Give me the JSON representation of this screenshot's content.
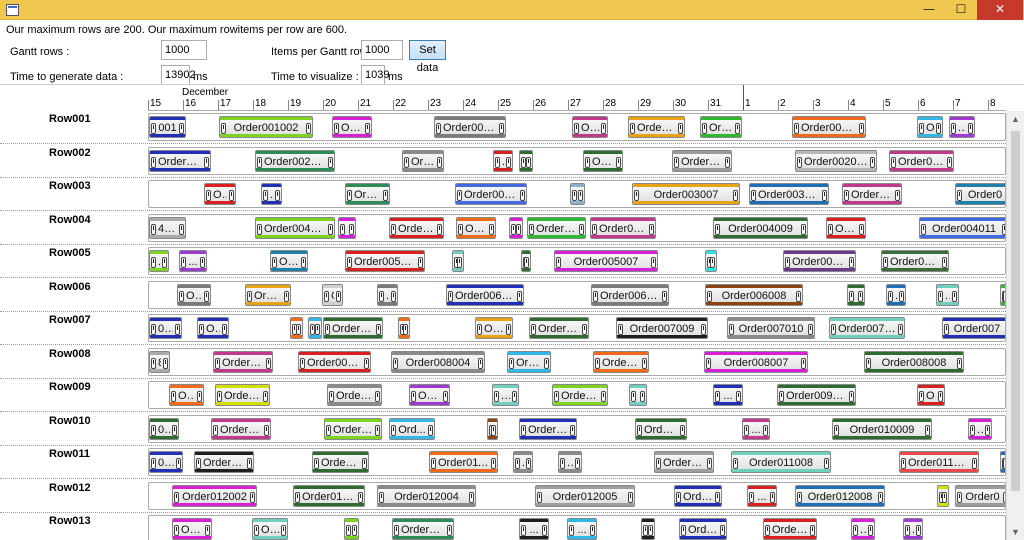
{
  "window": {
    "icon": "app-window-icon",
    "minimize_label": "—",
    "maximize_label": "☐",
    "close_label": "✕"
  },
  "info_text": "Our maximum rows are 200. Our maximum rowitems per row are 600.",
  "controls": {
    "gantt_rows_label": "Gantt rows :",
    "gantt_rows_value": "1000",
    "items_per_row_label": "Items per Gantt row :",
    "items_per_row_value": "1000",
    "set_data_label": "Set data",
    "time_generate_label": "Time to generate data :",
    "time_generate_value": "13902",
    "time_generate_unit": "ms",
    "time_visualize_label": "Time to visualize :",
    "time_visualize_value": "1039",
    "time_visualize_unit": "ms"
  },
  "timeline": {
    "month": "December",
    "days": [
      "15",
      "16",
      "17",
      "18",
      "19",
      "20",
      "21",
      "22",
      "23",
      "24",
      "25",
      "26",
      "27",
      "28",
      "29",
      "30",
      "31",
      "1",
      "2",
      "3",
      "4",
      "5",
      "6",
      "7",
      "8"
    ]
  },
  "rows": [
    {
      "name": "Row001",
      "items": [
        [
          "001",
          0,
          37,
          "#1f2fb8"
        ],
        [
          "Order001002",
          70,
          94,
          "#7ed321"
        ],
        [
          "Ord...",
          183,
          40,
          "#d61fd6"
        ],
        [
          "Order001004",
          285,
          72,
          "#7a7a7a"
        ],
        [
          "Or...",
          423,
          36,
          "#c0398a"
        ],
        [
          "Order00...",
          479,
          57,
          "#e8a317"
        ],
        [
          "Ord...",
          551,
          42,
          "#2eb82e"
        ],
        [
          "Order001008",
          643,
          74,
          "#f06a1a"
        ],
        [
          "O...",
          768,
          26,
          "#2fb7e8"
        ],
        [
          "...",
          800,
          26,
          "#9e3ad1"
        ]
      ]
    },
    {
      "name": "Row002",
      "items": [
        [
          "Order002002",
          0,
          62,
          "#1f2fb8"
        ],
        [
          "Order002003",
          106,
          80,
          "#2e8b57"
        ],
        [
          "Ord...",
          253,
          42,
          "#8a8a8a"
        ],
        [
          "...",
          344,
          20,
          "#d91f1f"
        ],
        [
          "...",
          370,
          14,
          "#2e6b2e"
        ],
        [
          "Ord...",
          434,
          40,
          "#2e6b2e"
        ],
        [
          "Order0...",
          523,
          60,
          "#9a9a9a"
        ],
        [
          "Order002009",
          646,
          82,
          "#b8b8b8"
        ],
        [
          "Order002...",
          740,
          65,
          "#c0398a"
        ]
      ]
    },
    {
      "name": "Row003",
      "items": [
        [
          "O...",
          55,
          32,
          "#d91f1f"
        ],
        [
          "...",
          112,
          21,
          "#1f2fb8"
        ],
        [
          "Orde...",
          196,
          45,
          "#2e8b57"
        ],
        [
          "Order003005",
          306,
          72,
          "#4169e1"
        ],
        [
          "...",
          421,
          15,
          "#8ab0d0"
        ],
        [
          "Order003007",
          483,
          108,
          "#e8a317"
        ],
        [
          "Order003008",
          600,
          80,
          "#1f6fb8"
        ],
        [
          "Order00...",
          693,
          60,
          "#c0398a"
        ],
        [
          "Order0",
          806,
          60,
          "#1e7fa8"
        ]
      ]
    },
    {
      "name": "Row004",
      "items": [
        [
          "4001",
          0,
          37,
          "#aaaaaa"
        ],
        [
          "Order004002",
          106,
          80,
          "#7ed321"
        ],
        [
          "...",
          189,
          18,
          "#d61fd6"
        ],
        [
          "Order0040...",
          240,
          55,
          "#d91f1f"
        ],
        [
          "Ord...",
          307,
          40,
          "#f06a1a"
        ],
        [
          "...",
          360,
          14,
          "#d61fd6"
        ],
        [
          "Order00...",
          378,
          59,
          "#2eb82e"
        ],
        [
          "Order0040...",
          441,
          66,
          "#c0398a"
        ],
        [
          "Order004009",
          564,
          95,
          "#2e6b2e"
        ],
        [
          "Ord...",
          677,
          40,
          "#d91f1f"
        ],
        [
          "Order004011",
          770,
          90,
          "#4169e1"
        ]
      ]
    },
    {
      "name": "Row005",
      "items": [
        [
          "...",
          0,
          20,
          "#7ed321"
        ],
        [
          "...",
          30,
          28,
          "#9e3ad1"
        ],
        [
          "Or...",
          121,
          38,
          "#1e7fa8"
        ],
        [
          "Order005004",
          196,
          80,
          "#d91f1f"
        ],
        [
          "...",
          303,
          12,
          "#6fcfc0"
        ],
        [
          "...",
          372,
          10,
          "#2e6b2e"
        ],
        [
          "Order005007",
          405,
          104,
          "#d61fd6"
        ],
        [
          "...",
          556,
          12,
          "#2fe0e0"
        ],
        [
          "Order005009",
          634,
          73,
          "#6b3a8a"
        ],
        [
          "Order005010",
          732,
          68,
          "#3a6b3a"
        ]
      ]
    },
    {
      "name": "Row006",
      "items": [
        [
          "Or...",
          28,
          34,
          "#7a7a7a"
        ],
        [
          "Orde...",
          96,
          46,
          "#e8a317"
        ],
        [
          "O...",
          173,
          21,
          "#d0d0d0"
        ],
        [
          "...",
          228,
          21,
          "#7a7a7a"
        ],
        [
          "Order006006",
          297,
          78,
          "#1f2fb8"
        ],
        [
          "Order006007",
          442,
          78,
          "#7a7a7a"
        ],
        [
          "Order006008",
          556,
          98,
          "#8b4513"
        ],
        [
          "...",
          698,
          18,
          "#2e6b2e"
        ],
        [
          "...",
          737,
          20,
          "#1f6fb8"
        ],
        [
          "...",
          787,
          23,
          "#6fcfc0"
        ],
        [
          "...",
          851,
          10,
          "#2eb82e"
        ]
      ]
    },
    {
      "name": "Row007",
      "items": [
        [
          "001",
          0,
          33,
          "#1f2fb8"
        ],
        [
          "O...",
          48,
          32,
          "#1f2fb8"
        ],
        [
          "...",
          141,
          13,
          "#f06a1a"
        ],
        [
          "...",
          159,
          14,
          "#2fb7e8"
        ],
        [
          "Order007...",
          174,
          60,
          "#2e6b2e"
        ],
        [
          "...",
          249,
          12,
          "#f06a1a"
        ],
        [
          "Or...",
          326,
          38,
          "#e8a317"
        ],
        [
          "Order00...",
          380,
          60,
          "#2e6b2e"
        ],
        [
          "Order007009",
          467,
          92,
          "#1f1f1f"
        ],
        [
          "Order007010",
          578,
          88,
          "#8a8a8a"
        ],
        [
          "Order007011",
          680,
          76,
          "#6fcfc0"
        ],
        [
          "Order007",
          793,
          70,
          "#1f2fb8"
        ]
      ]
    },
    {
      "name": "Row008",
      "items": [
        [
          "8001",
          0,
          21,
          "#aaaaaa"
        ],
        [
          "Order00...",
          64,
          60,
          "#c0398a"
        ],
        [
          "Order008003",
          149,
          73,
          "#d91f1f"
        ],
        [
          "Order008004",
          242,
          94,
          "#8a8a8a"
        ],
        [
          "Ord...",
          358,
          44,
          "#2fb7e8"
        ],
        [
          "Order0...",
          444,
          56,
          "#f06a1a"
        ],
        [
          "Order008007",
          555,
          104,
          "#d61fd6"
        ],
        [
          "Order008008",
          715,
          100,
          "#2e6b2e"
        ]
      ]
    },
    {
      "name": "Row009",
      "items": [
        [
          "O...",
          20,
          35,
          "#f06a1a"
        ],
        [
          "Order00...",
          66,
          55,
          "#d4e000"
        ],
        [
          "Order0...",
          178,
          55,
          "#8a8a8a"
        ],
        [
          "Ord...",
          260,
          41,
          "#9e3ad1"
        ],
        [
          "...",
          343,
          27,
          "#6fcfc0"
        ],
        [
          "Order00...",
          403,
          56,
          "#7ed321"
        ],
        [
          "...",
          480,
          18,
          "#6fcfc0"
        ],
        [
          "...",
          564,
          30,
          "#1f2fb8"
        ],
        [
          "Order009010",
          628,
          79,
          "#2e6b2e"
        ],
        [
          "O...",
          768,
          28,
          "#d91f1f"
        ]
      ]
    },
    {
      "name": "Row010",
      "items": [
        [
          "001",
          0,
          30,
          "#2e6b2e"
        ],
        [
          "Order010...",
          62,
          60,
          "#c0398a"
        ],
        [
          "Order01...",
          175,
          58,
          "#7ed321"
        ],
        [
          "Ord...",
          240,
          46,
          "#2fb7e8"
        ],
        [
          "...",
          338,
          11,
          "#8b4513"
        ],
        [
          "Order01...",
          370,
          58,
          "#1f2fb8"
        ],
        [
          "Order...",
          486,
          52,
          "#2e6b2e"
        ],
        [
          "...",
          593,
          28,
          "#c0398a"
        ],
        [
          "Order010009",
          683,
          100,
          "#2e6b2e"
        ],
        [
          "...",
          819,
          24,
          "#d61fd6"
        ]
      ]
    },
    {
      "name": "Row011",
      "items": [
        [
          "001",
          0,
          34,
          "#1f2fb8"
        ],
        [
          "Order011...",
          45,
          60,
          "#1f1f1f"
        ],
        [
          "Order01...",
          163,
          57,
          "#2e6b2e"
        ],
        [
          "Order0110...",
          280,
          69,
          "#f06a1a"
        ],
        [
          "...",
          364,
          20,
          "#8a8a8a"
        ],
        [
          "...",
          409,
          24,
          "#8a8a8a"
        ],
        [
          "Order01...",
          505,
          60,
          "#9e9e9e"
        ],
        [
          "Order011008",
          582,
          100,
          "#6fcfc0"
        ],
        [
          "Order011009",
          750,
          80,
          "#e84a4a"
        ],
        [
          "...",
          851,
          10,
          "#1f6fb8"
        ]
      ]
    },
    {
      "name": "Row012",
      "items": [
        [
          "Order012002",
          23,
          85,
          "#d61fd6"
        ],
        [
          "Order012003",
          144,
          72,
          "#2e6b2e"
        ],
        [
          "Order012004",
          228,
          99,
          "#8a8a8a"
        ],
        [
          "Order012005",
          386,
          100,
          "#9e9e9e"
        ],
        [
          "Order0...",
          525,
          48,
          "#1f2fb8"
        ],
        [
          "...",
          598,
          30,
          "#d91f1f"
        ],
        [
          "Order012008",
          646,
          90,
          "#1f6fb8"
        ],
        [
          "...",
          788,
          12,
          "#d4e000"
        ],
        [
          "Order0",
          806,
          55,
          "#9a9a9a"
        ]
      ]
    },
    {
      "name": "Row013",
      "items": [
        [
          "Order...",
          23,
          40,
          "#d61fd6"
        ],
        [
          "Orde...",
          103,
          36,
          "#6fcfc0"
        ],
        [
          "...",
          195,
          15,
          "#7ed321"
        ],
        [
          "Order00...",
          243,
          62,
          "#2e8b57"
        ],
        [
          "...",
          370,
          30,
          "#1f1f1f"
        ],
        [
          "...",
          418,
          30,
          "#2fb7e8"
        ],
        [
          "...",
          492,
          14,
          "#1f1f1f"
        ],
        [
          "Order...",
          530,
          48,
          "#1f2fb8"
        ],
        [
          "Order0...",
          614,
          54,
          "#d91f1f"
        ],
        [
          "...",
          702,
          24,
          "#d61fd6"
        ],
        [
          "...",
          754,
          20,
          "#9e3ad1"
        ],
        [
          "...",
          856,
          12,
          "#1f2fb8"
        ]
      ]
    }
  ]
}
